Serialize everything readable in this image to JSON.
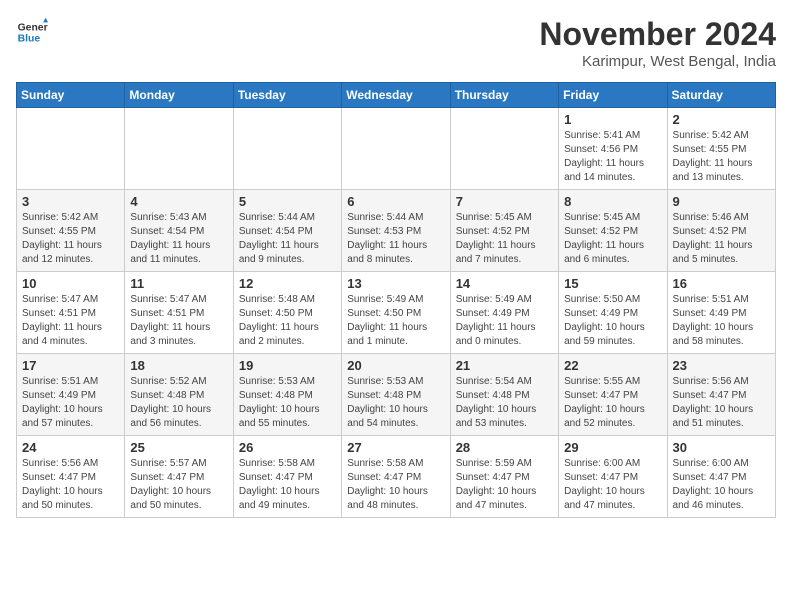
{
  "header": {
    "logo_line1": "General",
    "logo_line2": "Blue",
    "month": "November 2024",
    "location": "Karimpur, West Bengal, India"
  },
  "days_of_week": [
    "Sunday",
    "Monday",
    "Tuesday",
    "Wednesday",
    "Thursday",
    "Friday",
    "Saturday"
  ],
  "weeks": [
    [
      {
        "day": "",
        "info": ""
      },
      {
        "day": "",
        "info": ""
      },
      {
        "day": "",
        "info": ""
      },
      {
        "day": "",
        "info": ""
      },
      {
        "day": "",
        "info": ""
      },
      {
        "day": "1",
        "info": "Sunrise: 5:41 AM\nSunset: 4:56 PM\nDaylight: 11 hours\nand 14 minutes."
      },
      {
        "day": "2",
        "info": "Sunrise: 5:42 AM\nSunset: 4:55 PM\nDaylight: 11 hours\nand 13 minutes."
      }
    ],
    [
      {
        "day": "3",
        "info": "Sunrise: 5:42 AM\nSunset: 4:55 PM\nDaylight: 11 hours\nand 12 minutes."
      },
      {
        "day": "4",
        "info": "Sunrise: 5:43 AM\nSunset: 4:54 PM\nDaylight: 11 hours\nand 11 minutes."
      },
      {
        "day": "5",
        "info": "Sunrise: 5:44 AM\nSunset: 4:54 PM\nDaylight: 11 hours\nand 9 minutes."
      },
      {
        "day": "6",
        "info": "Sunrise: 5:44 AM\nSunset: 4:53 PM\nDaylight: 11 hours\nand 8 minutes."
      },
      {
        "day": "7",
        "info": "Sunrise: 5:45 AM\nSunset: 4:52 PM\nDaylight: 11 hours\nand 7 minutes."
      },
      {
        "day": "8",
        "info": "Sunrise: 5:45 AM\nSunset: 4:52 PM\nDaylight: 11 hours\nand 6 minutes."
      },
      {
        "day": "9",
        "info": "Sunrise: 5:46 AM\nSunset: 4:52 PM\nDaylight: 11 hours\nand 5 minutes."
      }
    ],
    [
      {
        "day": "10",
        "info": "Sunrise: 5:47 AM\nSunset: 4:51 PM\nDaylight: 11 hours\nand 4 minutes."
      },
      {
        "day": "11",
        "info": "Sunrise: 5:47 AM\nSunset: 4:51 PM\nDaylight: 11 hours\nand 3 minutes."
      },
      {
        "day": "12",
        "info": "Sunrise: 5:48 AM\nSunset: 4:50 PM\nDaylight: 11 hours\nand 2 minutes."
      },
      {
        "day": "13",
        "info": "Sunrise: 5:49 AM\nSunset: 4:50 PM\nDaylight: 11 hours\nand 1 minute."
      },
      {
        "day": "14",
        "info": "Sunrise: 5:49 AM\nSunset: 4:49 PM\nDaylight: 11 hours\nand 0 minutes."
      },
      {
        "day": "15",
        "info": "Sunrise: 5:50 AM\nSunset: 4:49 PM\nDaylight: 10 hours\nand 59 minutes."
      },
      {
        "day": "16",
        "info": "Sunrise: 5:51 AM\nSunset: 4:49 PM\nDaylight: 10 hours\nand 58 minutes."
      }
    ],
    [
      {
        "day": "17",
        "info": "Sunrise: 5:51 AM\nSunset: 4:49 PM\nDaylight: 10 hours\nand 57 minutes."
      },
      {
        "day": "18",
        "info": "Sunrise: 5:52 AM\nSunset: 4:48 PM\nDaylight: 10 hours\nand 56 minutes."
      },
      {
        "day": "19",
        "info": "Sunrise: 5:53 AM\nSunset: 4:48 PM\nDaylight: 10 hours\nand 55 minutes."
      },
      {
        "day": "20",
        "info": "Sunrise: 5:53 AM\nSunset: 4:48 PM\nDaylight: 10 hours\nand 54 minutes."
      },
      {
        "day": "21",
        "info": "Sunrise: 5:54 AM\nSunset: 4:48 PM\nDaylight: 10 hours\nand 53 minutes."
      },
      {
        "day": "22",
        "info": "Sunrise: 5:55 AM\nSunset: 4:47 PM\nDaylight: 10 hours\nand 52 minutes."
      },
      {
        "day": "23",
        "info": "Sunrise: 5:56 AM\nSunset: 4:47 PM\nDaylight: 10 hours\nand 51 minutes."
      }
    ],
    [
      {
        "day": "24",
        "info": "Sunrise: 5:56 AM\nSunset: 4:47 PM\nDaylight: 10 hours\nand 50 minutes."
      },
      {
        "day": "25",
        "info": "Sunrise: 5:57 AM\nSunset: 4:47 PM\nDaylight: 10 hours\nand 50 minutes."
      },
      {
        "day": "26",
        "info": "Sunrise: 5:58 AM\nSunset: 4:47 PM\nDaylight: 10 hours\nand 49 minutes."
      },
      {
        "day": "27",
        "info": "Sunrise: 5:58 AM\nSunset: 4:47 PM\nDaylight: 10 hours\nand 48 minutes."
      },
      {
        "day": "28",
        "info": "Sunrise: 5:59 AM\nSunset: 4:47 PM\nDaylight: 10 hours\nand 47 minutes."
      },
      {
        "day": "29",
        "info": "Sunrise: 6:00 AM\nSunset: 4:47 PM\nDaylight: 10 hours\nand 47 minutes."
      },
      {
        "day": "30",
        "info": "Sunrise: 6:00 AM\nSunset: 4:47 PM\nDaylight: 10 hours\nand 46 minutes."
      }
    ]
  ]
}
